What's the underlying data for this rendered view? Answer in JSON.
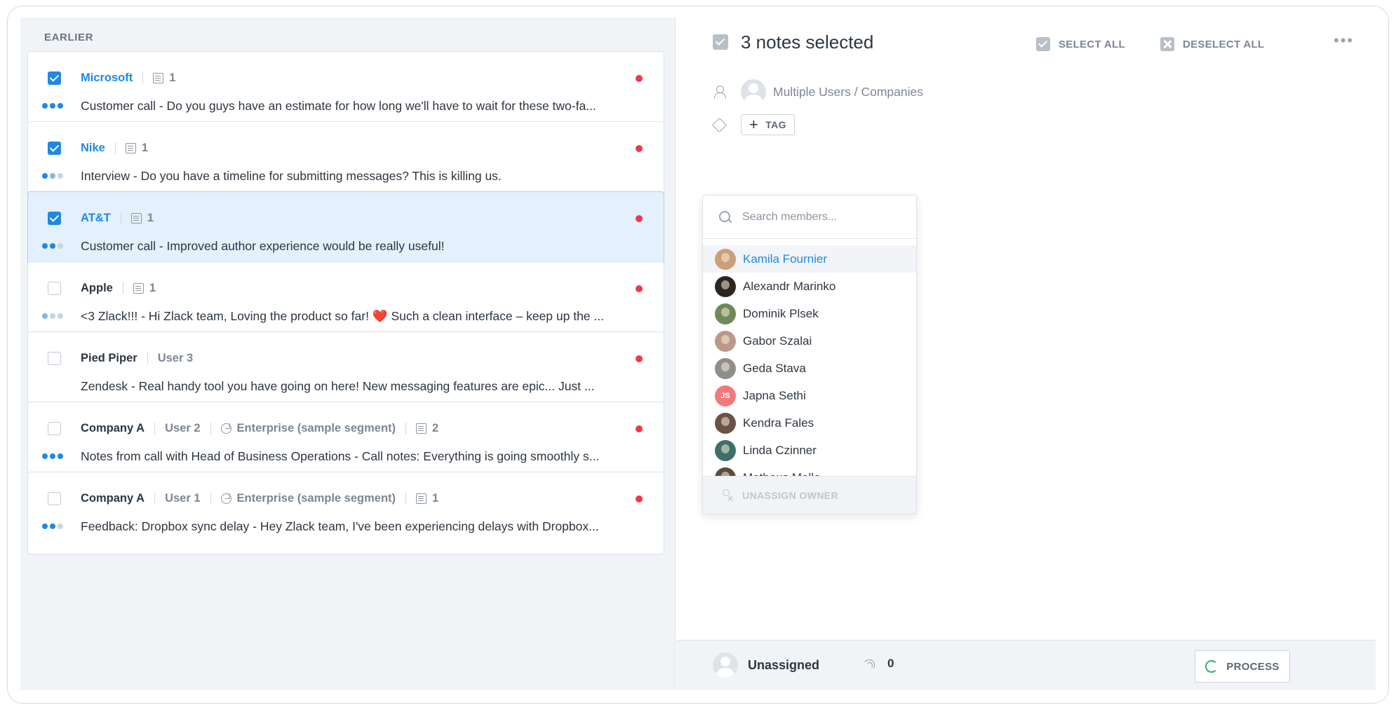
{
  "list": {
    "section_title": "EARLIER",
    "items": [
      {
        "company": "Microsoft",
        "company_link": true,
        "user": "",
        "segment": "",
        "note_count": "1",
        "checked": true,
        "selected": false,
        "dots": [
          "b",
          "b",
          "b"
        ],
        "text": "Customer call - Do you guys have an estimate for how long we'll have to wait for these two-fa..."
      },
      {
        "company": "Nike",
        "company_link": true,
        "user": "",
        "segment": "",
        "note_count": "1",
        "checked": true,
        "selected": false,
        "dots": [
          "b",
          "lb",
          "c"
        ],
        "text": "Interview - Do you have a timeline for submitting messages? This is killing us."
      },
      {
        "company": "AT&T",
        "company_link": true,
        "user": "",
        "segment": "",
        "note_count": "1",
        "checked": true,
        "selected": true,
        "dots": [
          "b",
          "b",
          "c"
        ],
        "text": "Customer call - Improved author experience would be really useful!"
      },
      {
        "company": "Apple",
        "company_link": false,
        "user": "",
        "segment": "",
        "note_count": "1",
        "checked": false,
        "selected": false,
        "dots": [
          "lb",
          "c",
          "c"
        ],
        "text_before": "<3 Zlack!!! - Hi Zlack team, Loving the product so far! ",
        "text_heart": "❤️",
        "text_after": " Such a clean interface – keep up the ..."
      },
      {
        "company": "Pied Piper",
        "company_link": false,
        "user": "User 3",
        "segment": "",
        "note_count": "",
        "checked": false,
        "selected": false,
        "dots": [],
        "text": "Zendesk - Real handy tool you have going on here! New messaging features are epic... Just ..."
      },
      {
        "company": "Company A",
        "company_link": false,
        "user": "User 2",
        "segment": "Enterprise (sample segment)",
        "note_count": "2",
        "checked": false,
        "selected": false,
        "dots": [
          "b",
          "b",
          "b"
        ],
        "text": "Notes from call with Head of Business Operations - Call notes: Everything is going smoothly s..."
      },
      {
        "company": "Company A",
        "company_link": false,
        "user": "User 1",
        "segment": "Enterprise (sample segment)",
        "note_count": "1",
        "checked": false,
        "selected": false,
        "dots": [
          "b",
          "b",
          "c"
        ],
        "text": "Feedback: Dropbox sync delay - Hey Zlack team, I've been experiencing delays with Dropbox..."
      }
    ]
  },
  "detail": {
    "title": "3 notes selected",
    "select_all": "SELECT ALL",
    "deselect_all": "DESELECT ALL",
    "more": "•••",
    "owner_label": "Multiple Users / Companies",
    "tag_button": "TAG"
  },
  "dropdown": {
    "search_placeholder": "Search members...",
    "members": [
      {
        "name": "Kamila Fournier",
        "active": true,
        "color": "#c9a07a"
      },
      {
        "name": "Alexandr Marinko",
        "active": false,
        "color": "#2b2622"
      },
      {
        "name": "Dominik Plsek",
        "active": false,
        "color": "#6f8a58"
      },
      {
        "name": "Gabor Szalai",
        "active": false,
        "color": "#b99a8a"
      },
      {
        "name": "Geda Stava",
        "active": false,
        "color": "#8e8e8e"
      },
      {
        "name": "Japna Sethi",
        "active": false,
        "color": "#f07a7a",
        "initials": "JS"
      },
      {
        "name": "Kendra Fales",
        "active": false,
        "color": "#6a5346"
      },
      {
        "name": "Linda Czinner",
        "active": false,
        "color": "#3f6f6a"
      },
      {
        "name": "Matheus Mello",
        "active": false,
        "color": "#5a4a40"
      }
    ],
    "footer": "UNASSIGN OWNER"
  },
  "bottom": {
    "owner": "Unassigned",
    "count": "0",
    "process": "PROCESS"
  },
  "colors": {
    "accent": "#1e88e5",
    "red_dot": "#f0384a",
    "process_icon": "#2cb36b"
  }
}
